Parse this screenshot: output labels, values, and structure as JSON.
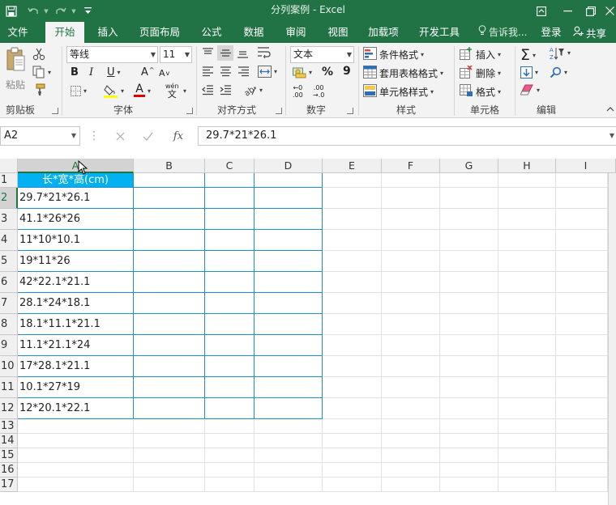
{
  "window": {
    "title": "分列案例 - Excel"
  },
  "ribbon_tabs": [
    "文件",
    "开始",
    "插入",
    "页面布局",
    "公式",
    "数据",
    "审阅",
    "视图",
    "加载项",
    "开发工具"
  ],
  "tell_me": "告诉我...",
  "account": {
    "login": "登录",
    "share": "共享"
  },
  "clipboard": {
    "paste": "粘贴",
    "label": "剪贴板"
  },
  "font": {
    "name": "等线",
    "size": "11",
    "label": "字体",
    "bold": "B",
    "italic": "I",
    "underline": "U",
    "grow": "A",
    "shrink": "A",
    "color_a": "A",
    "phonetic_top": "wén",
    "phonetic_bottom": "文"
  },
  "alignment": {
    "label": "对齐方式"
  },
  "number": {
    "format": "文本",
    "percent": "%",
    "comma": "9",
    "label": "数字",
    "inc_top": "←0",
    "inc_bottom": ".00",
    "dec_top": ".00",
    "dec_bottom": "→.0"
  },
  "styles": {
    "conditional": "条件格式",
    "table": "套用表格格式",
    "cell": "单元格样式",
    "label": "样式"
  },
  "cells": {
    "insert": "插入",
    "delete": "删除",
    "format": "格式",
    "label": "单元格"
  },
  "editing": {
    "label": "编辑"
  },
  "formula_bar": {
    "name_box": "A2",
    "fx": "fx",
    "formula": "29.7*21*26.1"
  },
  "sheet": {
    "columns": [
      "A",
      "B",
      "C",
      "D",
      "E",
      "F",
      "G",
      "H",
      "I"
    ],
    "rows": [
      "1",
      "2",
      "3",
      "4",
      "5",
      "6",
      "7",
      "8",
      "9",
      "10",
      "11",
      "12",
      "13",
      "14",
      "15",
      "16",
      "17"
    ],
    "header_cell": "长*宽*高(cm)",
    "values": [
      "29.7*21*26.1",
      "41.1*26*26",
      "11*10*10.1",
      "19*11*26",
      "42*22.1*21.1",
      "28.1*24*18.1",
      "18.1*11.1*21.1",
      "11.1*21.1*24",
      "17*28.1*21.1",
      "10.1*27*19",
      "12*20.1*22.1"
    ],
    "selected_cell": "A2"
  },
  "colors": {
    "brand": "#217346",
    "table_header_fill": "#00b0f0",
    "table_border": "#1f8fc7"
  }
}
